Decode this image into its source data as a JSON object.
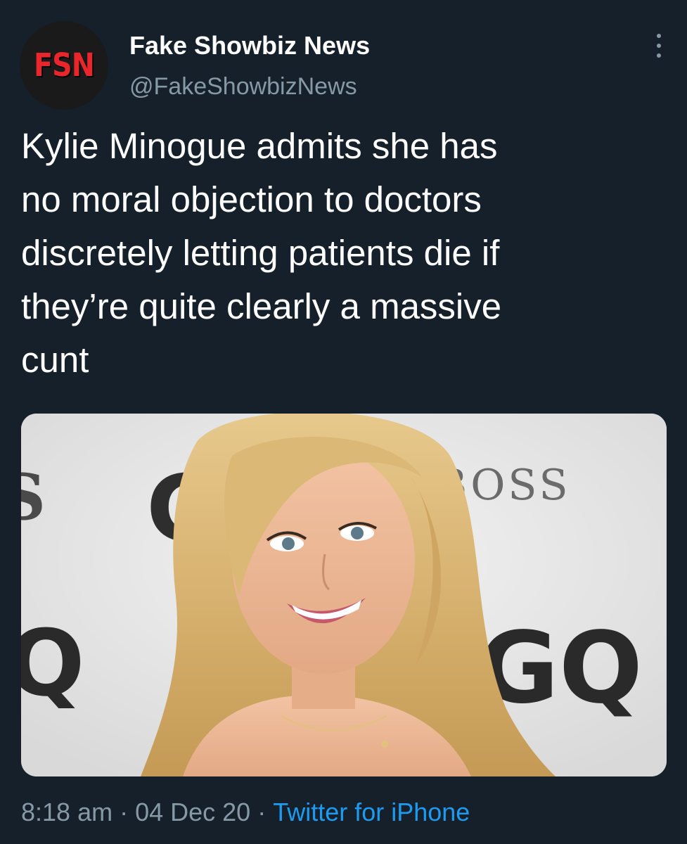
{
  "author": {
    "avatar_text": "FSN",
    "name": "Fake Showbiz News",
    "handle": "@FakeShowbizNews"
  },
  "tweet": {
    "text": "Kylie Minogue admits she has\nno moral objection to doctors\ndiscretely letting patients die if\nthey’re quite clearly a massive\ncunt"
  },
  "media": {
    "backdrop_text_1": "BOSS",
    "backdrop_text_2": "GQ"
  },
  "footer": {
    "time": "8:18 am",
    "separator": "·",
    "date": "04 Dec 20",
    "source": "Twitter for iPhone"
  },
  "colors": {
    "background": "#15202b",
    "secondary_text": "#8899a6",
    "link": "#1d9bf0",
    "avatar_brand": "#e8262b"
  },
  "icons": {
    "more": "more-vertical-icon"
  }
}
